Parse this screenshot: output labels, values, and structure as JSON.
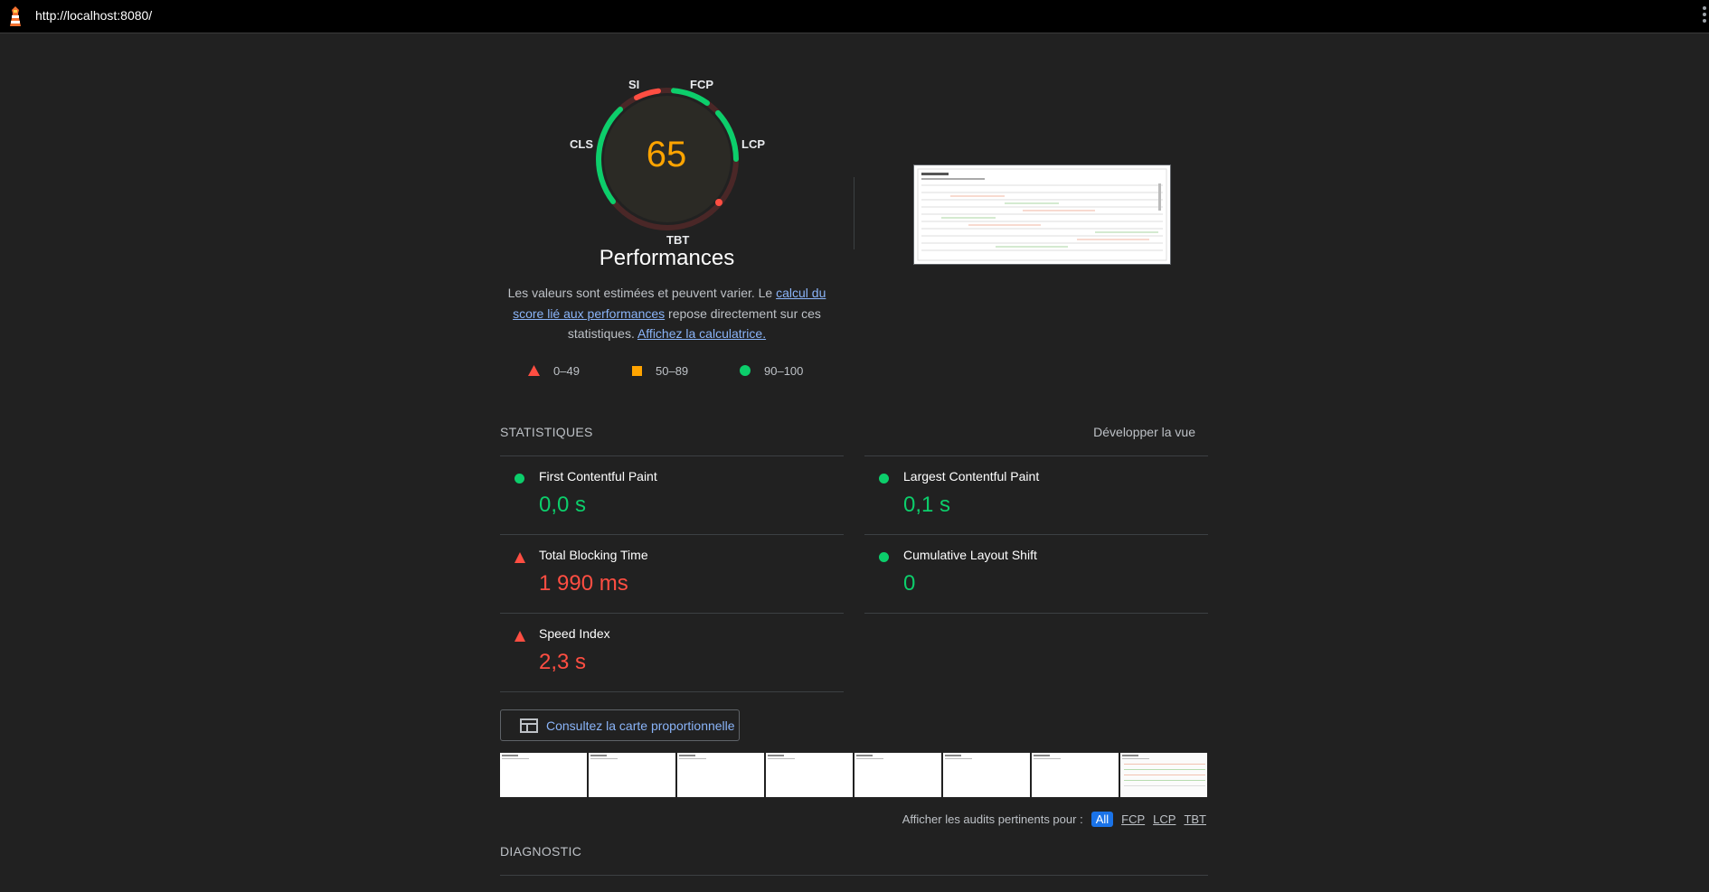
{
  "browser": {
    "url": "http://localhost:8080/"
  },
  "gauge": {
    "score": "65",
    "labels": {
      "si": "SI",
      "fcp": "FCP",
      "lcp": "LCP",
      "tbt": "TBT",
      "cls": "CLS"
    },
    "score_color": "#ffa400"
  },
  "performance": {
    "title": "Performances",
    "description_1": "Les valeurs sont estimées et peuvent varier. Le ",
    "link_calc": "calcul du score lié aux performances",
    "description_2": " repose directement sur ces statistiques. ",
    "link_calculator": "Affichez la calculatrice."
  },
  "legend": {
    "fail": "0–49",
    "average": "50–89",
    "pass": "90–100"
  },
  "metrics": {
    "section_title": "STATISTIQUES",
    "expand_label": "Développer la vue",
    "items": [
      {
        "name": "First Contentful Paint",
        "value": "0,0 s",
        "status": "pass"
      },
      {
        "name": "Largest Contentful Paint",
        "value": "0,1 s",
        "status": "pass"
      },
      {
        "name": "Total Blocking Time",
        "value": "1 990 ms",
        "status": "fail"
      },
      {
        "name": "Cumulative Layout Shift",
        "value": "0",
        "status": "pass"
      },
      {
        "name": "Speed Index",
        "value": "2,3 s",
        "status": "fail"
      }
    ]
  },
  "treemap": {
    "label": "Consultez la carte proportionnelle"
  },
  "audits_filter": {
    "label": "Afficher les audits pertinents pour :",
    "options": [
      "All",
      "FCP",
      "LCP",
      "TBT"
    ],
    "selected": "All"
  },
  "diagnostics": {
    "title": "DIAGNOSTIC"
  },
  "colors": {
    "pass": "#0cce6b",
    "average": "#ffa400",
    "fail": "#ff4e42",
    "link": "#8ab4f8"
  }
}
